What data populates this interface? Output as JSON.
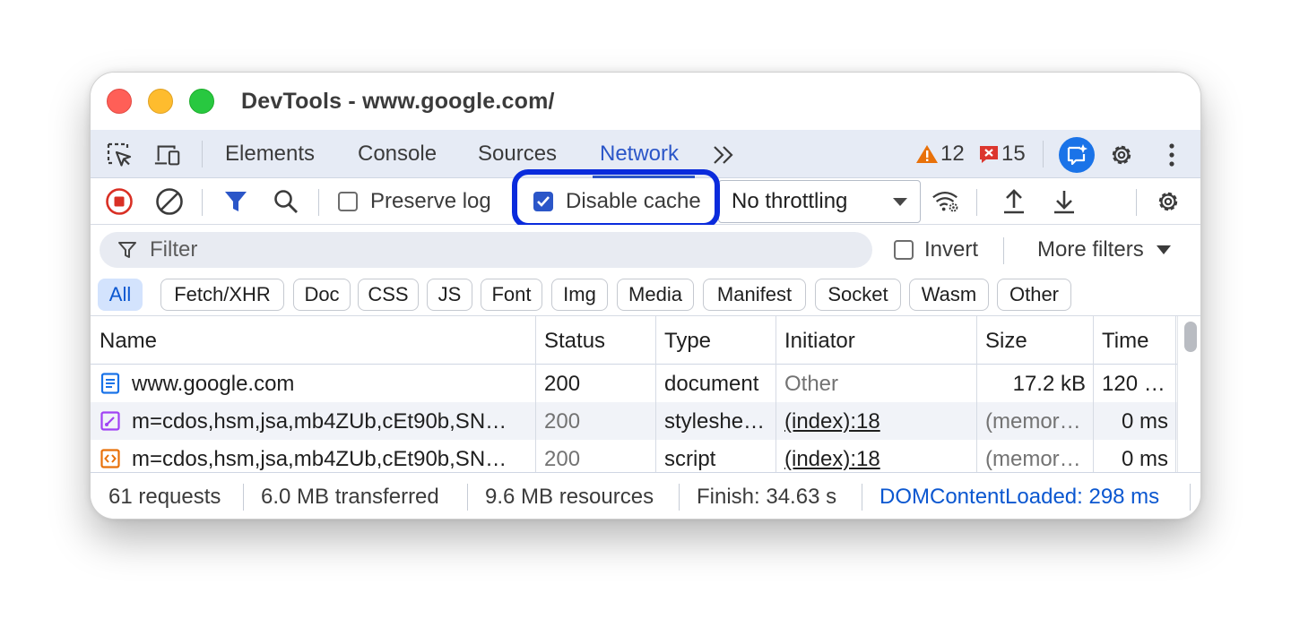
{
  "window": {
    "title": "DevTools - www.google.com/"
  },
  "tabs": {
    "items": [
      "Elements",
      "Console",
      "Sources",
      "Network"
    ],
    "active": "Network",
    "warnings_count": "12",
    "errors_count": "15"
  },
  "toolbar": {
    "preserve_log_label": "Preserve log",
    "preserve_log_checked": false,
    "disable_cache_label": "Disable cache",
    "disable_cache_checked": true,
    "throttling_value": "No throttling"
  },
  "filter": {
    "placeholder": "Filter",
    "invert_label": "Invert",
    "more_filters_label": "More filters"
  },
  "type_filters": [
    "All",
    "Fetch/XHR",
    "Doc",
    "CSS",
    "JS",
    "Font",
    "Img",
    "Media",
    "Manifest",
    "Socket",
    "Wasm",
    "Other"
  ],
  "table": {
    "headers": [
      "Name",
      "Status",
      "Type",
      "Initiator",
      "Size",
      "Time"
    ],
    "rows": [
      {
        "icon": "document-icon",
        "name": "www.google.com",
        "status": "200",
        "type": "document",
        "initiator": "Other",
        "size": "17.2 kB",
        "time": "120 …"
      },
      {
        "icon": "stylesheet-icon",
        "name": "m=cdos,hsm,jsa,mb4ZUb,cEt90b,SN…",
        "status": "200",
        "type": "styleshe…",
        "initiator": "(index):18",
        "size": "(memor…",
        "time": "0 ms"
      },
      {
        "icon": "script-icon",
        "name": "m=cdos,hsm,jsa,mb4ZUb,cEt90b,SN…",
        "status": "200",
        "type": "script",
        "initiator": "(index):18",
        "size": "(memor…",
        "time": "0 ms"
      }
    ]
  },
  "status_bar": {
    "requests": "61 requests",
    "transferred": "6.0 MB transferred",
    "resources": "9.6 MB resources",
    "finish": "Finish: 34.63 s",
    "dom_content_loaded": "DOMContentLoaded: 298 ms"
  },
  "colors": {
    "accent": "#2b56c8",
    "highlight_border": "#0a2bdc",
    "warning": "#e8710a",
    "error": "#dc362e",
    "ai_button": "#1a73e8"
  }
}
